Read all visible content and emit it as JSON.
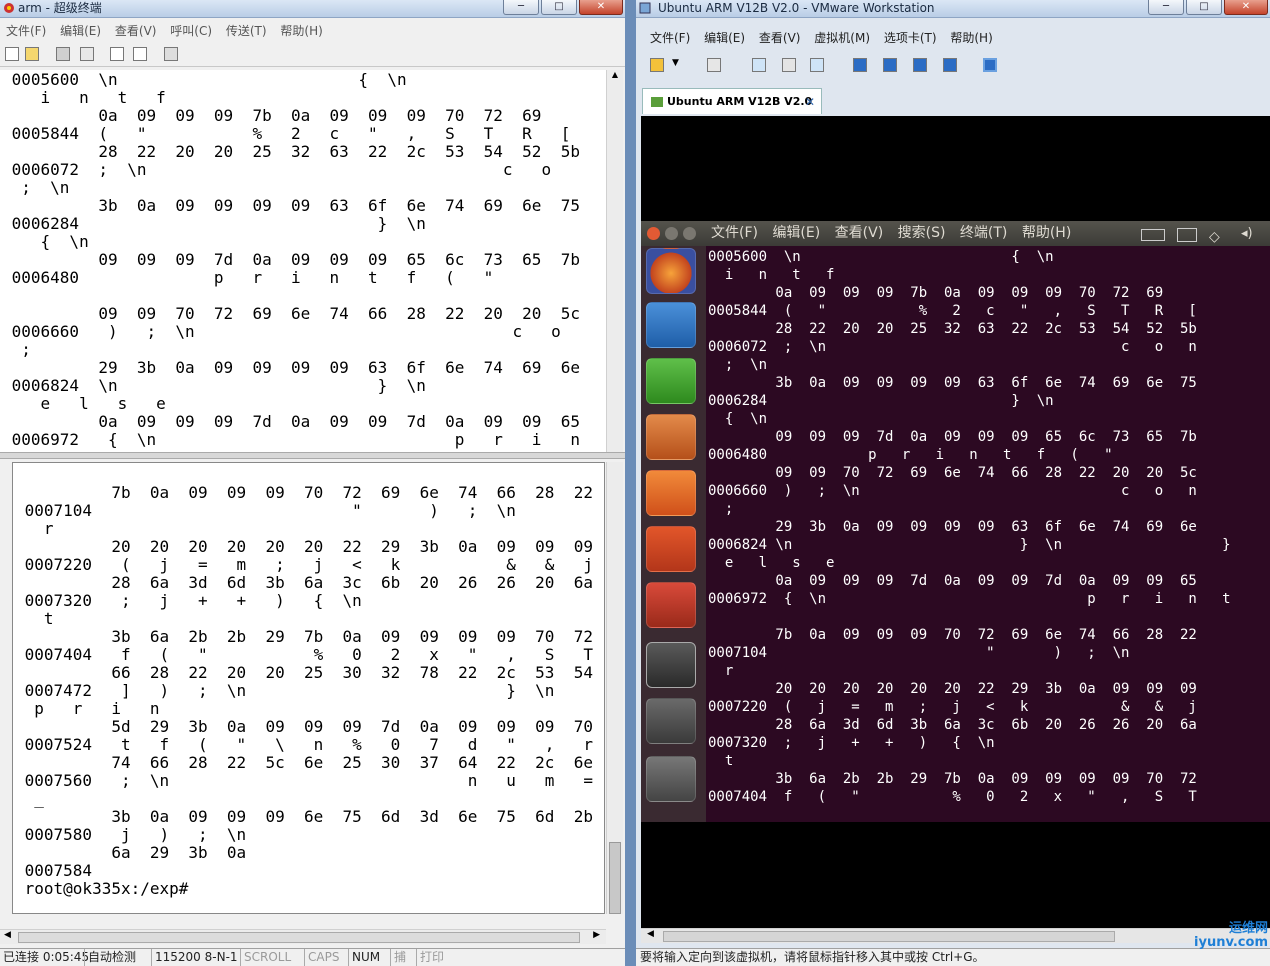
{
  "left_window": {
    "title": "arm - 超级终端",
    "menu": [
      "文件(F)",
      "编辑(E)",
      "查看(V)",
      "呼叫(C)",
      "传送(T)",
      "帮助(H)"
    ],
    "upper_lines": [
      " 0005600  \\n                         {  \\n",
      "    i   n   t   f",
      "          0a  09  09  09  7b  0a  09  09  09  70  72  69",
      " 0005844  (   \"           %   2   c   \"   ,   S   T   R   [",
      "          28  22  20  20  25  32  63  22  2c  53  54  52  5b",
      " 0006072  ;  \\n                                     c   o",
      "  ;  \\n",
      "          3b  0a  09  09  09  09  63  6f  6e  74  69  6e  75",
      " 0006284                               }  \\n",
      "    {  \\n",
      "          09  09  09  7d  0a  09  09  09  65  6c  73  65  7b",
      " 0006480              p   r   i   n   t   f   (   \"",
      "",
      "          09  09  70  72  69  6e  74  66  28  22  20  20  5c",
      " 0006660   )   ;  \\n                                 c   o",
      "  ;",
      "          29  3b  0a  09  09  09  09  63  6f  6e  74  69  6e",
      " 0006824  \\n                           }  \\n",
      "    e   l   s   e",
      "          0a  09  09  09  7d  0a  09  09  7d  0a  09  09  65",
      " 0006972   {  \\n                               p   r   i   n"
    ],
    "lower_lines": [
      "",
      "          7b  0a  09  09  09  70  72  69  6e  74  66  28  22",
      " 0007104                           \"       )   ;  \\n",
      "   r",
      "          20  20  20  20  20  20  22  29  3b  0a  09  09  09",
      " 0007220   (   j   =   m   ;   j   <   k           &   &   j",
      "          28  6a  3d  6d  3b  6a  3c  6b  20  26  26  20  6a",
      " 0007320   ;   j   +   +   )   {  \\n",
      "   t",
      "          3b  6a  2b  2b  29  7b  0a  09  09  09  09  70  72",
      " 0007404   f   (   \"           %   0   2   x   \"   ,   S   T",
      "          66  28  22  20  20  25  30  32  78  22  2c  53  54",
      " 0007472   ]   )   ;  \\n                           }  \\n",
      "  p   r   i   n",
      "          5d  29  3b  0a  09  09  09  7d  0a  09  09  09  70",
      " 0007524   t   f   (   \"   \\   n   %   0   7   d   \"   ,   r",
      "          74  66  28  22  5c  6e  25  30  37  64  22  2c  6e",
      " 0007560   ;  \\n                               n   u   m   =",
      "  _",
      "          3b  0a  09  09  09  6e  75  6d  3d  6e  75  6d  2b",
      " 0007580   j   )   ;  \\n",
      "          6a  29  3b  0a",
      " 0007584",
      " root@ok335x:/exp#"
    ],
    "status": {
      "connected": "已连接 0:05:45",
      "detect": "自动检测",
      "baud": "115200 8-N-1",
      "scroll": "SCROLL",
      "caps": "CAPS",
      "num": "NUM",
      "capture": "捕",
      "print": "打印"
    }
  },
  "right_window": {
    "title": "Ubuntu ARM V12B V2.0 - VMware Workstation",
    "menu": [
      "文件(F)",
      "编辑(E)",
      "查看(V)",
      "虚拟机(M)",
      "选项卡(T)",
      "帮助(H)"
    ],
    "tab_label": "Ubuntu ARM V12B V2.0",
    "ubuntu_menu": [
      "文件(F)",
      "编辑(E)",
      "查看(V)",
      "搜索(S)",
      "终端(T)",
      "帮助(H)"
    ],
    "terminal_lines": [
      "0005600  \\n                         {  \\n",
      "  i   n   t   f",
      "        0a  09  09  09  7b  0a  09  09  09  70  72  69",
      "0005844  (   \"           %   2   c   \"   ,   S   T   R   [",
      "        28  22  20  20  25  32  63  22  2c  53  54  52  5b",
      "0006072  ;  \\n                                   c   o   n",
      "  ;  \\n",
      "        3b  0a  09  09  09  09  63  6f  6e  74  69  6e  75",
      "0006284                             }  \\n",
      "  {  \\n",
      "        09  09  09  7d  0a  09  09  09  65  6c  73  65  7b",
      "0006480            p   r   i   n   t   f   (   \"",
      "        09  09  70  72  69  6e  74  66  28  22  20  20  5c",
      "0006660  )   ;  \\n                               c   o   n",
      "  ;",
      "        29  3b  0a  09  09  09  09  63  6f  6e  74  69  6e",
      "0006824 \\n                           }  \\n                   }",
      "  e   l   s   e",
      "        0a  09  09  09  7d  0a  09  09  7d  0a  09  09  65",
      "0006972  {  \\n                               p   r   i   n   t",
      "",
      "        7b  0a  09  09  09  70  72  69  6e  74  66  28  22",
      "0007104                          \"       )   ;  \\n",
      "  r",
      "        20  20  20  20  20  20  22  29  3b  0a  09  09  09",
      "0007220  (   j   =   m   ;   j   <   k           &   &   j",
      "        28  6a  3d  6d  3b  6a  3c  6b  20  26  26  20  6a",
      "0007320  ;   j   +   +   )   {  \\n",
      "  t",
      "        3b  6a  2b  2b  29  7b  0a  09  09  09  09  70  72",
      "0007404  f   (   \"           %   0   2   x   \"   ,   S   T"
    ],
    "status_text": "要将输入定向到该虚拟机，请将鼠标指针移入其中或按 Ctrl+G。",
    "watermark": "运维网 iyunv.com"
  }
}
